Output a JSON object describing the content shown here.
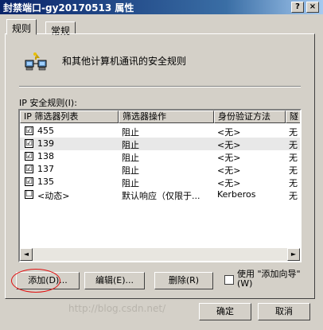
{
  "window": {
    "title": "封禁端口-gy20170513 属性",
    "help_btn": "?",
    "close_btn": "×"
  },
  "tabs": [
    {
      "label": "规则",
      "active": true
    },
    {
      "label": "常规",
      "active": false
    }
  ],
  "header": {
    "icon": "network-computers-icon",
    "text": "和其他计算机通讯的安全规则"
  },
  "rules_list": {
    "label": "IP 安全规则(I):",
    "columns": [
      "IP 筛选器列表",
      "筛选器操作",
      "身份验证方法",
      "隧"
    ],
    "rows": [
      {
        "checked": true,
        "checkbox": "☑",
        "filter": "455",
        "action": "阻止",
        "auth": "<无>",
        "tunnel": "无"
      },
      {
        "checked": true,
        "checkbox": "☑",
        "filter": "139",
        "action": "阻止",
        "auth": "<无>",
        "tunnel": "无"
      },
      {
        "checked": true,
        "checkbox": "☑",
        "filter": "138",
        "action": "阻止",
        "auth": "<无>",
        "tunnel": "无"
      },
      {
        "checked": true,
        "checkbox": "☑",
        "filter": "137",
        "action": "阻止",
        "auth": "<无>",
        "tunnel": "无"
      },
      {
        "checked": true,
        "checkbox": "☑",
        "filter": "135",
        "action": "阻止",
        "auth": "<无>",
        "tunnel": "无"
      },
      {
        "checked": false,
        "checkbox": "☐",
        "filter": "<动态>",
        "action": "默认响应（仅限于...",
        "auth": "Kerberos",
        "tunnel": "无"
      }
    ],
    "selected_row": 1,
    "scroll_left": "◄",
    "scroll_right": "►"
  },
  "buttons": {
    "add": "添加(D)...",
    "edit": "编辑(E)...",
    "remove": "删除(R)",
    "ok": "确定",
    "cancel": "取消"
  },
  "wizard": {
    "label": "使用 \"添加向导\"(W)",
    "checked": false
  },
  "watermark": "http://blog.csdn.net/"
}
